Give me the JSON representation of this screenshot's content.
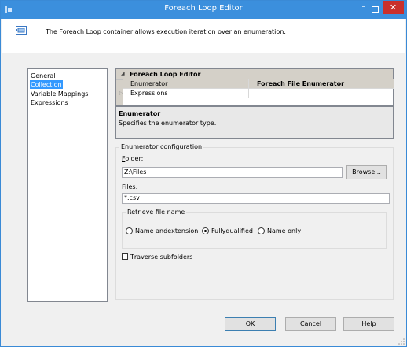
{
  "window": {
    "title": "Foreach Loop Editor",
    "minimize_glyph": "–",
    "close_glyph": "✕",
    "title_color": "#3b8fdd",
    "close_color": "#c9302c"
  },
  "header": {
    "description": "The Foreach Loop container allows execution iteration over an enumeration.",
    "icon": "loop-container-icon"
  },
  "sidebar": {
    "items": [
      {
        "label": "General",
        "selected": false
      },
      {
        "label": "Collection",
        "selected": true
      },
      {
        "label": "Variable Mappings",
        "selected": false
      },
      {
        "label": "Expressions",
        "selected": false
      }
    ]
  },
  "property_grid": {
    "category": "Foreach Loop Editor",
    "rows": [
      {
        "name": "Enumerator",
        "value": "Foreach File Enumerator"
      },
      {
        "name": "Expressions",
        "value": ""
      }
    ]
  },
  "description_panel": {
    "title": "Enumerator",
    "text": "Specifies the enumerator type."
  },
  "enumerator_config": {
    "group_title": "Enumerator configuration",
    "folder": {
      "label_pre": "",
      "label_ul": "F",
      "label_post": "older:",
      "value": "Z:\\Files"
    },
    "browse": {
      "label_pre": "",
      "label_ul": "B",
      "label_post": "rowse..."
    },
    "files": {
      "label_pre": "F",
      "label_ul": "i",
      "label_post": "les:",
      "value": "*.csv"
    },
    "retrieve": {
      "title": "Retrieve file name",
      "options": [
        {
          "pre": "Name and ",
          "ul": "e",
          "post": "xtension",
          "checked": false
        },
        {
          "pre": "Fully ",
          "ul": "q",
          "post": "ualified",
          "checked": true
        },
        {
          "pre": "",
          "ul": "N",
          "post": "ame only",
          "checked": false
        }
      ]
    },
    "traverse": {
      "pre": "",
      "ul": "T",
      "post": "raverse subfolders",
      "checked": false
    }
  },
  "footer": {
    "ok": "OK",
    "cancel": "Cancel",
    "help": {
      "pre": "",
      "ul": "H",
      "post": "elp"
    }
  }
}
